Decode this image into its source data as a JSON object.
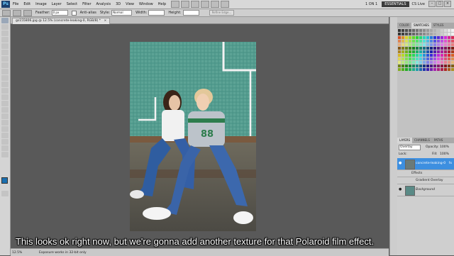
{
  "app": {
    "logo": "Ps"
  },
  "menu": [
    "File",
    "Edit",
    "Image",
    "Layer",
    "Select",
    "Filter",
    "Analysis",
    "3D",
    "View",
    "Window",
    "Help"
  ],
  "header_right": {
    "workspace": "1 ON 1",
    "essentials": "ESSENTIALS",
    "cs_live": "CS Live"
  },
  "options": {
    "feather_label": "Feather:",
    "feather_value": "0 px",
    "antialias_label": "Anti-alias",
    "style_label": "Style:",
    "style_value": "Normal",
    "width_label": "Width:",
    "height_label": "Height:",
    "refine_button": "Refine Edge..."
  },
  "document": {
    "tab_title": "gs155806.jpg @ 12.5% (concrete-leaking-0, RGB/8) *",
    "close": "×"
  },
  "status": {
    "zoom": "12.5%",
    "message": "Exposure works in 32-bit only"
  },
  "panels": {
    "top_tabs": [
      "COLOR",
      "SWATCHES",
      "STYLES"
    ],
    "layer_tabs": [
      "LAYERS",
      "CHANNELS",
      "PATHS"
    ],
    "blend_mode": "Overlay",
    "opacity_label": "Opacity:",
    "opacity_value": "100%",
    "lock_label": "Lock:",
    "fill_label": "Fill:",
    "fill_value": "100%",
    "layers": [
      {
        "name": "concrete-leaking-0",
        "fx": "fx"
      },
      {
        "name": "Effects"
      },
      {
        "name": "Gradient Overlay"
      },
      {
        "name": "Background"
      }
    ]
  },
  "caption": "This looks ok right now, but we're gonna add another texture for that Polaroid film effect.",
  "colors": {
    "accent_selected_layer": "#3d8fe0",
    "canvas": "#595959"
  }
}
